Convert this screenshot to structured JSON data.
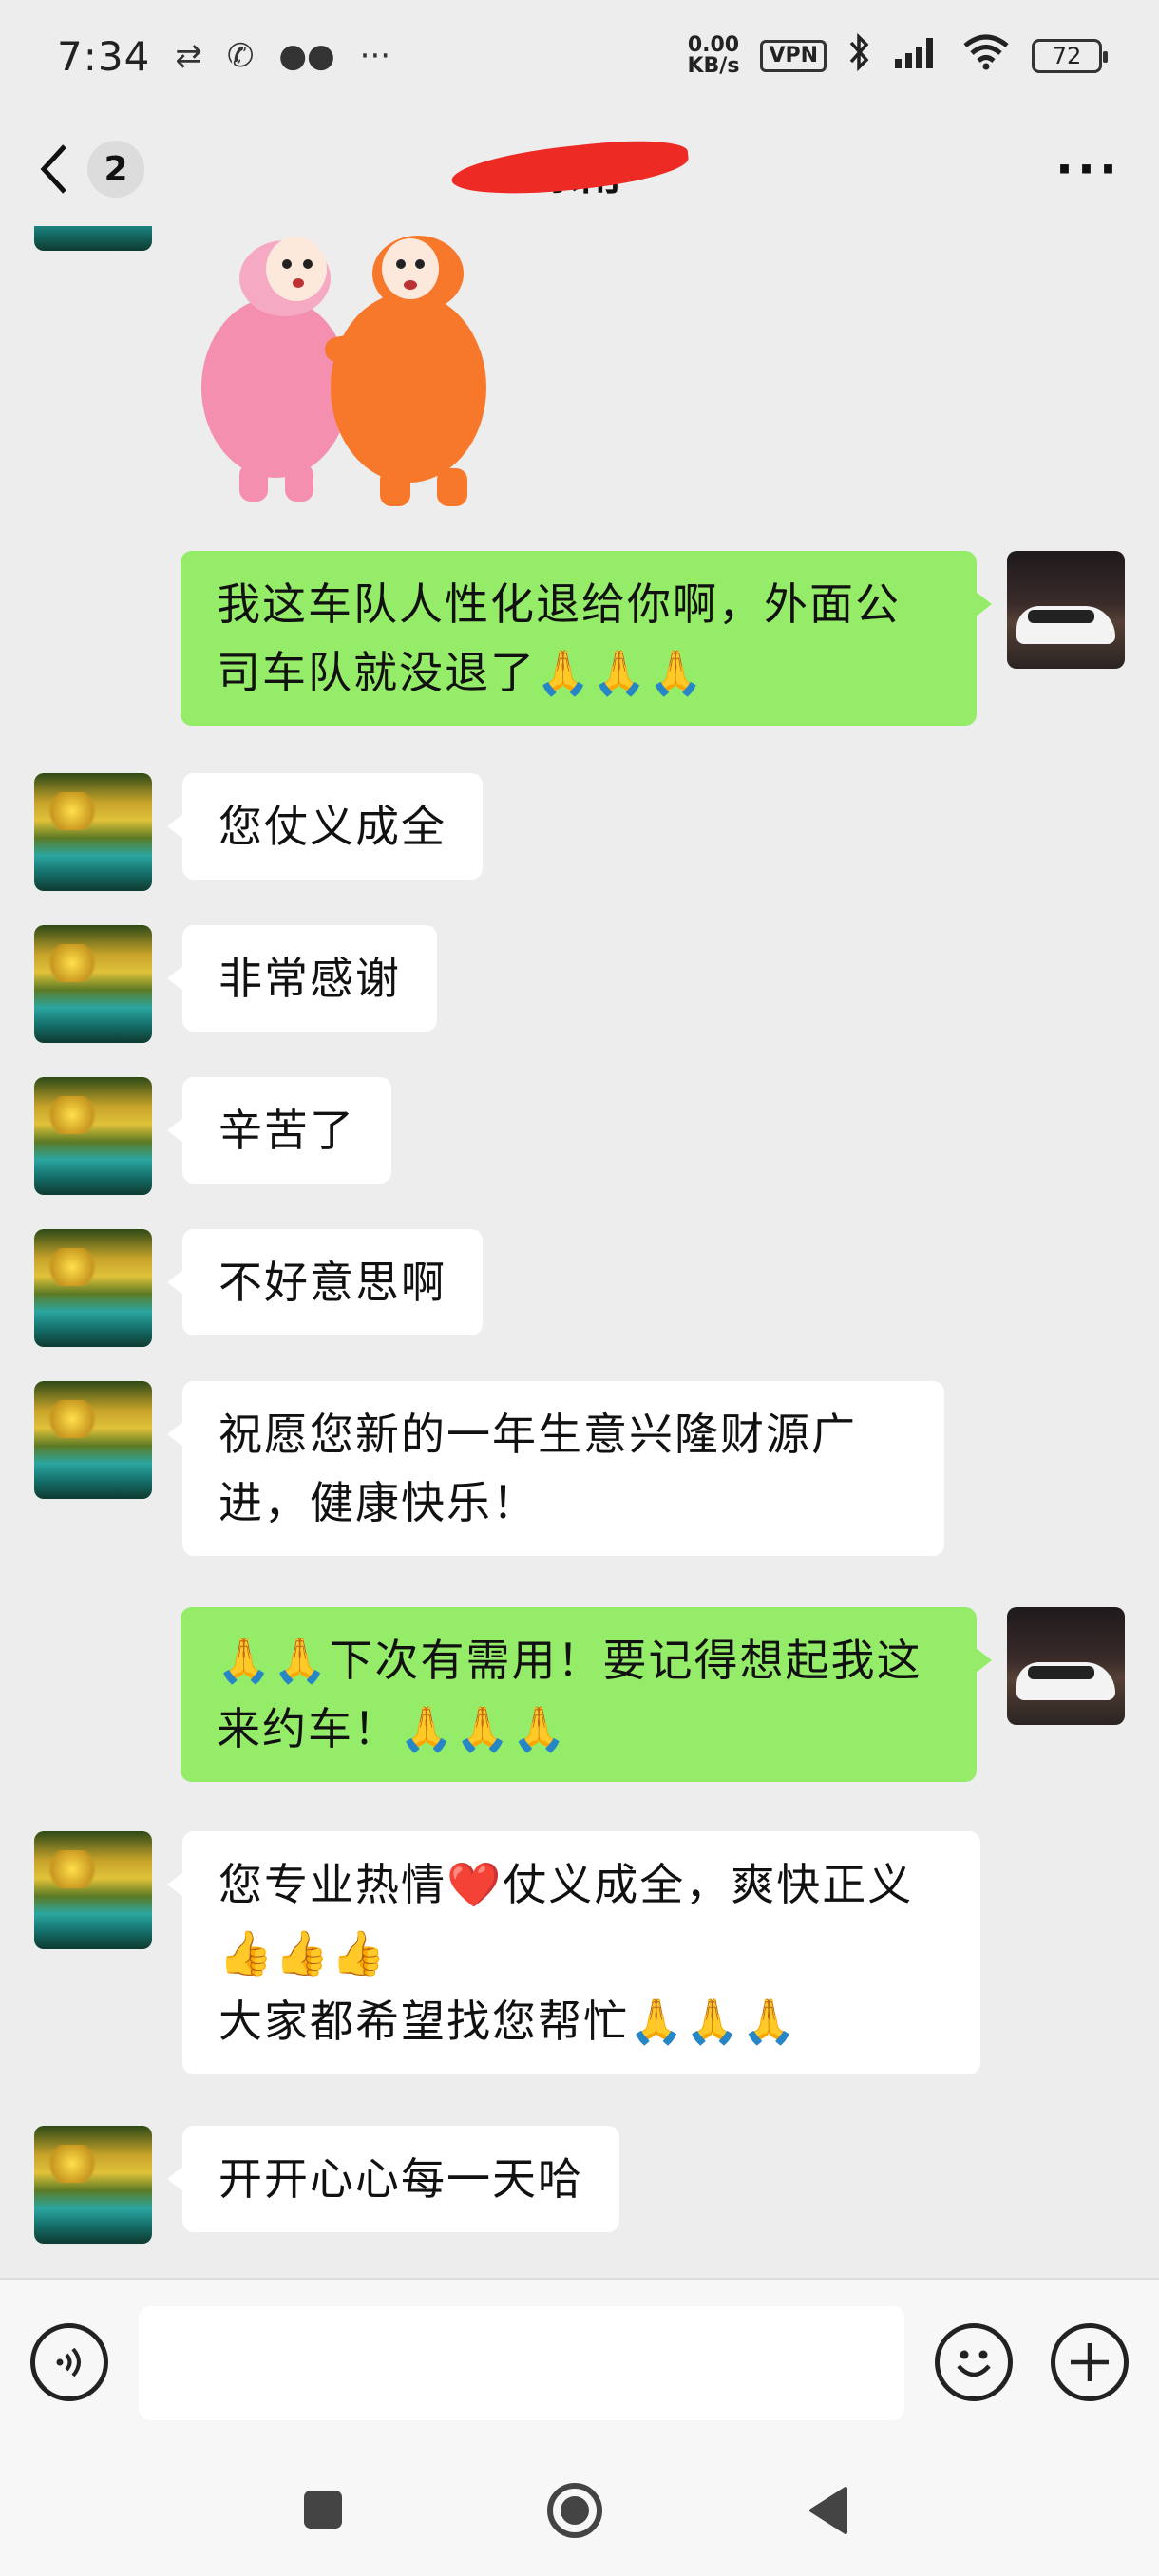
{
  "status_bar": {
    "time": "7:34",
    "net_speed_value": "0.00",
    "net_speed_unit": "KB/s",
    "vpn": "VPN",
    "battery": "72"
  },
  "header": {
    "unread_count": "2",
    "title": "东南"
  },
  "messages": [
    {
      "side": "out",
      "text": "我这车队人性化退给你啊，外面公司车队就没退了🙏🙏🙏"
    },
    {
      "side": "in",
      "text": "您仗义成全"
    },
    {
      "side": "in",
      "text": "非常感谢"
    },
    {
      "side": "in",
      "text": "辛苦了"
    },
    {
      "side": "in",
      "text": "不好意思啊"
    },
    {
      "side": "in",
      "text": "祝愿您新的一年生意兴隆财源广进，健康快乐！"
    },
    {
      "side": "out",
      "text": "🙏🙏下次有需用！要记得想起我这来约车！🙏🙏🙏"
    },
    {
      "side": "in",
      "text": "您专业热情❤️仗义成全，爽快正义👍👍👍\n大家都希望找您帮忙🙏🙏🙏"
    },
    {
      "side": "in",
      "text": "开开心心每一天哈"
    }
  ],
  "input": {
    "placeholder": ""
  },
  "colors": {
    "background": "#ededed",
    "outgoing_bubble": "#95ec69",
    "incoming_bubble": "#ffffff"
  }
}
